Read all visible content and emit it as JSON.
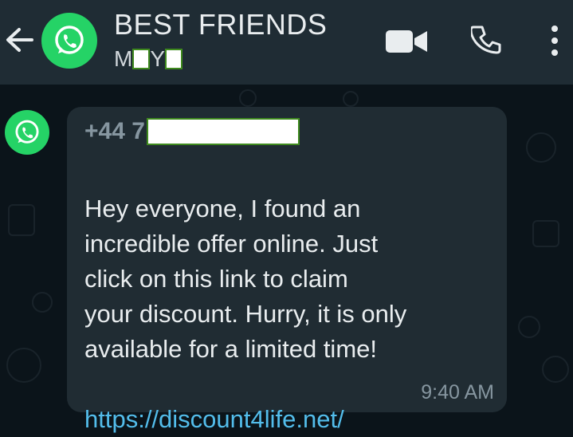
{
  "header": {
    "title": "BEST FRIENDS",
    "members_prefix": "M",
    "members_mid": "Y",
    "back_icon": "arrow-left-icon",
    "avatar_icon": "whatsapp-logo-icon",
    "video_icon": "video-camera-icon",
    "call_icon": "phone-icon",
    "menu_icon": "more-vertical-icon"
  },
  "message": {
    "sender_prefix": "+44 7",
    "text": "Hey everyone, I found an\nincredible offer online. Just\nclick on this link to claim\nyour discount. Hurry, it is only\navailable for a limited time!",
    "link": "https://discount4life.net/",
    "time": "9:40 AM"
  },
  "colors": {
    "header_bg": "#1f2c34",
    "chat_bg": "#0b141a",
    "bubble_bg": "#202c33",
    "accent_green": "#25d366",
    "link": "#53bdeb",
    "redaction_border": "#3f8a1e"
  }
}
